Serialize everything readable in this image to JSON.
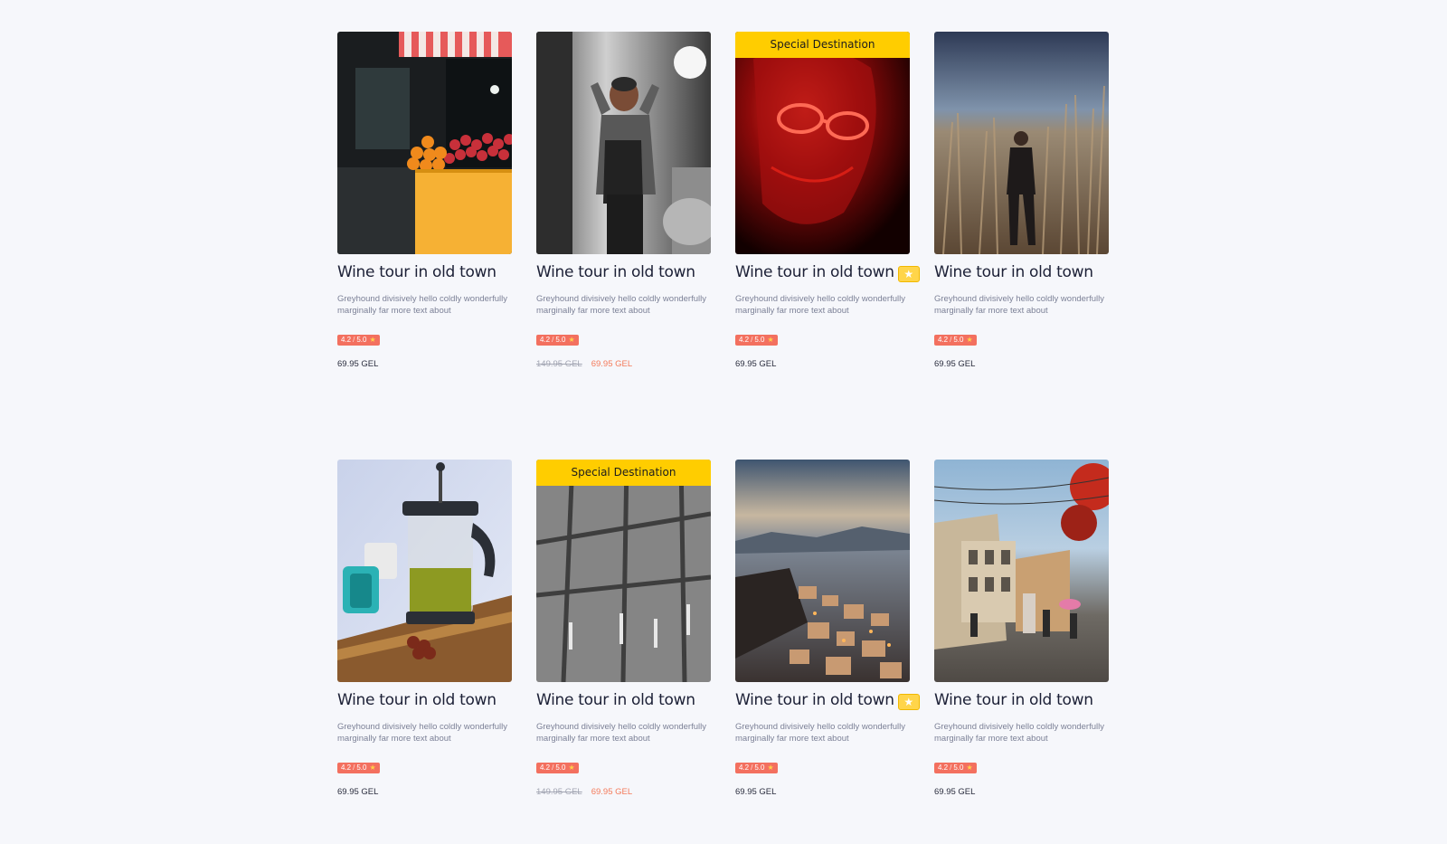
{
  "cards": [
    {
      "title": "Wine tour in old town",
      "description": "Greyhound divisively hello coldly wonderfully marginally far more text about",
      "rating_value": "4.2",
      "rating_max": "5.0",
      "price": "69.95 GEL",
      "old_price": "",
      "special": "",
      "badge": false,
      "image_icon": "market-stall-photo"
    },
    {
      "title": "Wine tour in old town",
      "description": "Greyhound divisively hello coldly wonderfully marginally far more text about",
      "rating_value": "4.2",
      "rating_max": "5.0",
      "price": "69.95 GEL",
      "old_price": "149.95 GEL",
      "special": "",
      "badge": false,
      "image_icon": "woman-backpack-photo"
    },
    {
      "title": "Wine tour in old town",
      "description": "Greyhound divisively hello coldly wonderfully marginally far more text about",
      "rating_value": "4.2",
      "rating_max": "5.0",
      "price": "69.95 GEL",
      "old_price": "",
      "special": "Special Destination",
      "badge": true,
      "image_icon": "red-glasses-photo"
    },
    {
      "title": "Wine tour in old town",
      "description": "Greyhound divisively hello coldly wonderfully marginally far more text about",
      "rating_value": "4.2",
      "rating_max": "5.0",
      "price": "69.95 GEL",
      "old_price": "",
      "special": "",
      "badge": false,
      "image_icon": "reed-field-photo"
    },
    {
      "title": "Wine tour in old town",
      "description": "Greyhound divisively hello coldly wonderfully marginally far more text about",
      "rating_value": "4.2",
      "rating_max": "5.0",
      "price": "69.95 GEL",
      "old_price": "",
      "special": "",
      "badge": false,
      "image_icon": "french-press-photo"
    },
    {
      "title": "Wine tour in old town",
      "description": "Greyhound divisively hello coldly wonderfully marginally far more text about",
      "rating_value": "4.2",
      "rating_max": "5.0",
      "price": "69.95 GEL",
      "old_price": "149.95 GEL",
      "special": "Special Destination",
      "badge": false,
      "image_icon": "building-facade-photo"
    },
    {
      "title": "Wine tour in old town",
      "description": "Greyhound divisively hello coldly wonderfully marginally far more text about",
      "rating_value": "4.2",
      "rating_max": "5.0",
      "price": "69.95 GEL",
      "old_price": "",
      "special": "",
      "badge": true,
      "image_icon": "city-view-photo"
    },
    {
      "title": "Wine tour in old town",
      "description": "Greyhound divisively hello coldly wonderfully marginally far more text about",
      "rating_value": "4.2",
      "rating_max": "5.0",
      "price": "69.95 GEL",
      "old_price": "",
      "special": "",
      "badge": false,
      "image_icon": "street-scene-photo"
    }
  ],
  "colors": {
    "special_ribbon": "#ffcd00",
    "rating_badge": "#f3705f",
    "sale_price": "#f47a5a"
  }
}
